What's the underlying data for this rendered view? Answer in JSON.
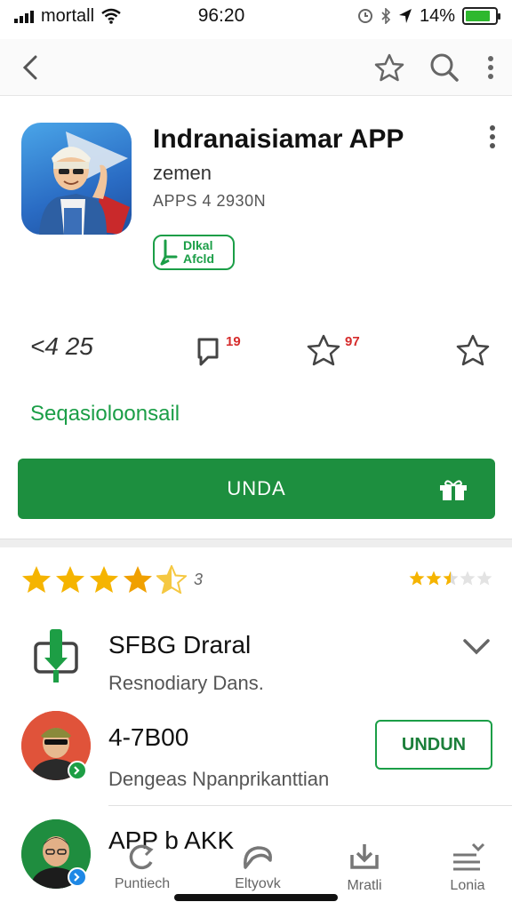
{
  "status": {
    "carrier": "mortall",
    "time": "96:20",
    "battery": "14%"
  },
  "app": {
    "title": "Indranaisiamar APP",
    "developer": "zemen",
    "meta": "APPS 4 2930N",
    "badge_line1": "Dlkal",
    "badge_line2": "Afcld"
  },
  "stats": {
    "downloads": "<4 25",
    "reviews_count": "19",
    "stars_count": "97"
  },
  "section_link": "Seqasioloonsail",
  "install_button": "UNDA",
  "ratings": {
    "big_stars": 4.5,
    "big_count": "3",
    "small_stars": 2.5
  },
  "list": [
    {
      "title": "SFBG Draral",
      "subtitle": "Resnodiary Dans."
    },
    {
      "title": "4-7B00",
      "subtitle": "Dengeas Npanprikanttian",
      "button": "UNDUN"
    },
    {
      "title": "APP b AKK"
    }
  ],
  "bottom_nav": [
    {
      "label": "Puntiech",
      "icon": "refresh-icon"
    },
    {
      "label": "Eltyovk",
      "icon": "explore-icon"
    },
    {
      "label": "Mratli",
      "icon": "download-icon"
    },
    {
      "label": "Lonia",
      "icon": "menu-icon"
    }
  ],
  "colors": {
    "accent_green": "#1d8f3f",
    "star_gold": "#f5b400",
    "count_red": "#d62c2c"
  }
}
